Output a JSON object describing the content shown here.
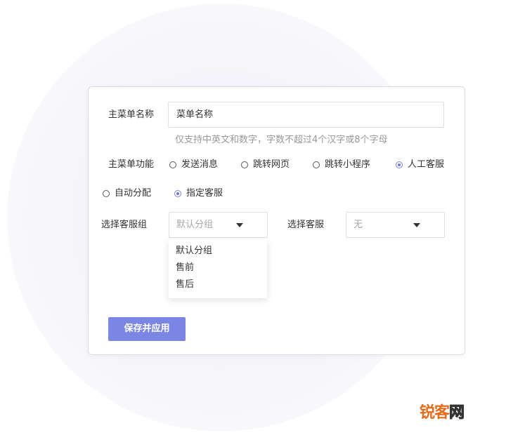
{
  "form": {
    "menu_name_label": "主菜单名称",
    "menu_name_value": "菜单名称",
    "menu_name_hint": "仅支持中英文和数字，字数不超过4个汉字或8个字母",
    "function_label": "主菜单功能",
    "function_options": [
      {
        "label": "发送消息",
        "checked": false
      },
      {
        "label": "跳转网页",
        "checked": false
      },
      {
        "label": "跳转小程序",
        "checked": false
      },
      {
        "label": "人工客服",
        "checked": true
      }
    ],
    "assign_options": [
      {
        "label": "自动分配",
        "checked": false
      },
      {
        "label": "指定客服",
        "checked": true
      }
    ],
    "group_label": "选择客服组",
    "group_selected": "默认分组",
    "group_options": [
      "默认分组",
      "售前",
      "售后"
    ],
    "agent_label": "选择客服",
    "agent_selected": "无",
    "save_label": "保存并应用"
  },
  "watermark": {
    "part1": "锐",
    "part2": "客",
    "part3": "网"
  },
  "colors": {
    "accent": "#7b86e4",
    "radio_checked": "#6d79d6",
    "border": "#dcdfe6",
    "hint_text": "#999999",
    "watermark_orange": "#e36b1b"
  }
}
